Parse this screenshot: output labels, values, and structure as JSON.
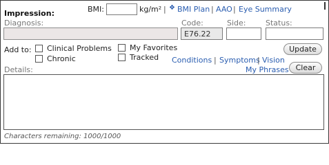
{
  "impression": {
    "title": "Impression:",
    "bmi_label": "BMI:",
    "bmi_value": "",
    "bmi_unit": "kg/m²",
    "links": {
      "separator": "|",
      "bmi_plan_icon": "diamond-icon",
      "bmi_plan": "BMI Plan",
      "aao": "AAO",
      "eye_summary": "Eye Summary"
    }
  },
  "diagnosis": {
    "label": "Diagnosis:",
    "value": ""
  },
  "code": {
    "label": "Code:",
    "value": "E76.22"
  },
  "side": {
    "label": "Side:",
    "value": ""
  },
  "status": {
    "label": "Status:",
    "value": ""
  },
  "add_to": {
    "label": "Add to:",
    "options": {
      "clinical_problems": "Clinical Problems",
      "chronic": "Chronic",
      "my_favorites": "My Favorites",
      "tracked": "Tracked"
    }
  },
  "buttons": {
    "update": "Update",
    "clear": "Clear"
  },
  "quick_links": {
    "conditions": "Conditions",
    "symptoms": "Symptoms",
    "vision": "Vision",
    "my_phrases": "My Phrases",
    "separator": "|"
  },
  "details": {
    "label": "Details:",
    "value": ""
  },
  "footer": {
    "chars_remaining": "Characters remaining: 1000/1000"
  }
}
